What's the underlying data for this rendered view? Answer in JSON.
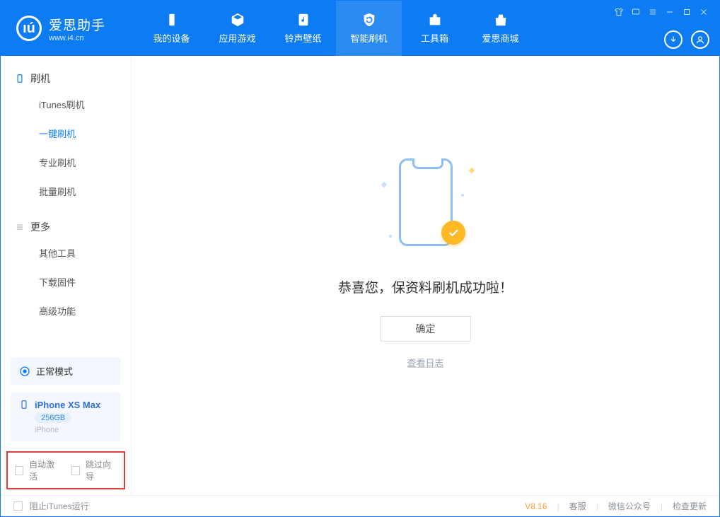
{
  "app": {
    "name_cn": "爱思助手",
    "name_en": "www.i4.cn"
  },
  "nav": {
    "items": [
      {
        "label": "我的设备"
      },
      {
        "label": "应用游戏"
      },
      {
        "label": "铃声壁纸"
      },
      {
        "label": "智能刷机"
      },
      {
        "label": "工具箱"
      },
      {
        "label": "爱思商城"
      }
    ],
    "active_index": 3
  },
  "sidebar": {
    "section1_title": "刷机",
    "section1_items": [
      "iTunes刷机",
      "一键刷机",
      "专业刷机",
      "批量刷机"
    ],
    "section1_active_index": 1,
    "section2_title": "更多",
    "section2_items": [
      "其他工具",
      "下载固件",
      "高级功能"
    ],
    "mode_label": "正常模式",
    "device": {
      "name": "iPhone XS Max",
      "capacity": "256GB",
      "type": "iPhone"
    },
    "checkbox_auto_activate": "自动激活",
    "checkbox_skip_guide": "跳过向导"
  },
  "main": {
    "success_msg": "恭喜您，保资料刷机成功啦！",
    "ok_label": "确定",
    "log_link": "查看日志"
  },
  "footer": {
    "block_itunes": "阻止iTunes运行",
    "version": "V8.16",
    "links": [
      "客服",
      "微信公众号",
      "检查更新"
    ]
  }
}
